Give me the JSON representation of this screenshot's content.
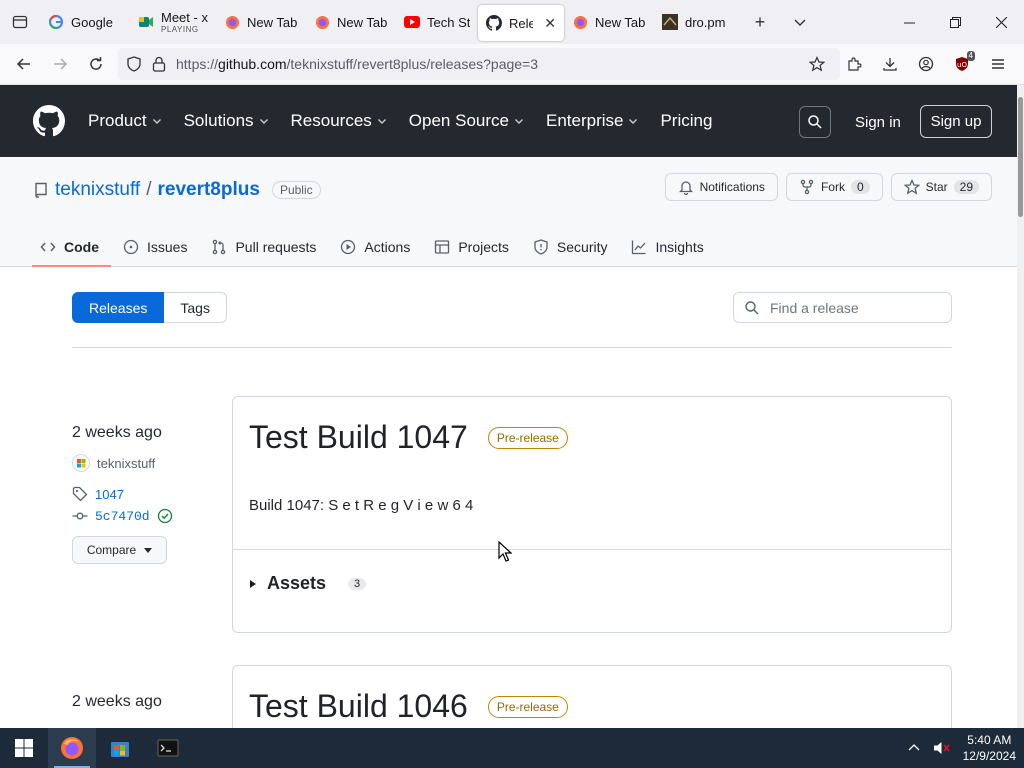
{
  "browser": {
    "tabs": [
      {
        "label": "Google",
        "icon": "google-icon"
      },
      {
        "label": "Meet - x",
        "sub": "PLAYING",
        "icon": "meet-icon"
      },
      {
        "label": "New Tab",
        "icon": "firefox-icon"
      },
      {
        "label": "New Tab",
        "icon": "firefox-icon"
      },
      {
        "label": "Tech Stu",
        "icon": "youtube-icon"
      },
      {
        "label": "Relea",
        "icon": "github-icon",
        "active": true
      },
      {
        "label": "New Tab",
        "icon": "firefox-icon"
      },
      {
        "label": "dro.pm",
        "icon": "dropm-icon"
      }
    ],
    "url_prefix": "https://",
    "url_host": "github.com",
    "url_path": "/teknixstuff/revert8plus/releases?page=3",
    "extension_badge": "4"
  },
  "gh_header": {
    "menu": [
      "Product",
      "Solutions",
      "Resources",
      "Open Source",
      "Enterprise",
      "Pricing"
    ],
    "sign_in": "Sign in",
    "sign_up": "Sign up"
  },
  "repo": {
    "owner": "teknixstuff",
    "separator": "/",
    "name": "revert8plus",
    "visibility": "Public",
    "notifications_label": "Notifications",
    "fork_label": "Fork",
    "fork_count": "0",
    "star_label": "Star",
    "star_count": "29",
    "tabs": [
      "Code",
      "Issues",
      "Pull requests",
      "Actions",
      "Projects",
      "Security",
      "Insights"
    ]
  },
  "releases_page": {
    "releases_tab": "Releases",
    "tags_tab": "Tags",
    "search_placeholder": "Find a release"
  },
  "releases": [
    {
      "date": "2 weeks ago",
      "author": "teknixstuff",
      "tag": "1047",
      "commit": "5c7470d",
      "compare_label": "Compare",
      "title": "Test Build 1047",
      "badge": "Pre-release",
      "description": "Build 1047: S e t R e g V i e w 6 4",
      "assets_label": "Assets",
      "assets_count": "3"
    },
    {
      "date": "2 weeks ago",
      "title": "Test Build 1046",
      "badge": "Pre-release"
    }
  ],
  "taskbar": {
    "time": "5:40 AM",
    "date": "12/9/2024"
  },
  "colors": {
    "accent": "#0969da",
    "gh_header_bg": "#24292f",
    "prerelease": "#9a6700",
    "active_tab_underline": "#fd8c73"
  }
}
